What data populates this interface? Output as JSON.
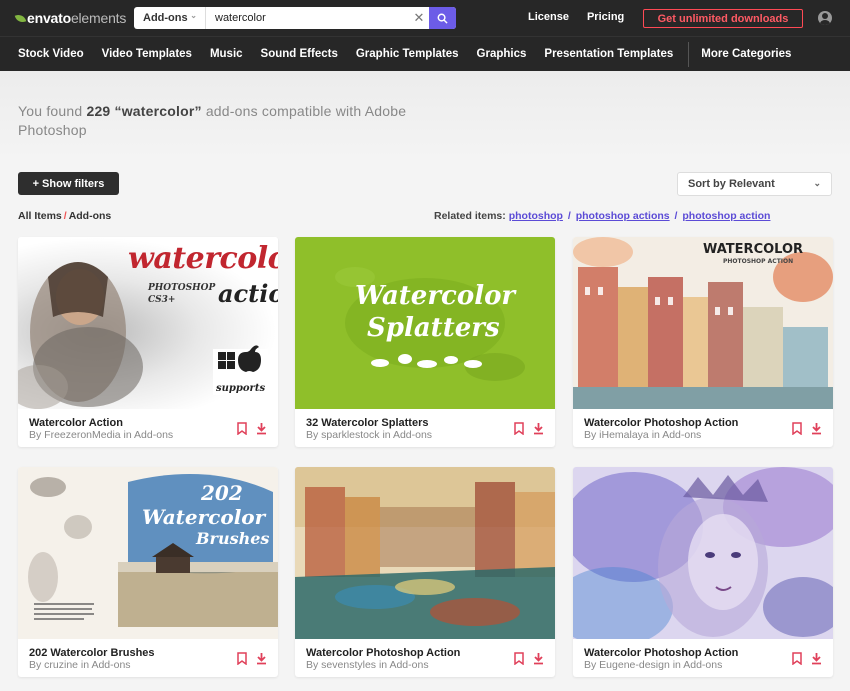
{
  "header": {
    "logo_main": "envato",
    "logo_sub": "elements",
    "search_category": "Add-ons",
    "search_value": "watercolor",
    "links": [
      "License",
      "Pricing"
    ],
    "cta": "Get unlimited downloads"
  },
  "nav": {
    "items": [
      "Stock Video",
      "Video Templates",
      "Music",
      "Sound Effects",
      "Graphic Templates",
      "Graphics",
      "Presentation Templates"
    ],
    "more": "More Categories"
  },
  "results": {
    "prefix": "You found",
    "count": "229",
    "query": "“watercolor”",
    "suffix": "add-ons compatible with Adobe Photoshop"
  },
  "filters": {
    "show_filters": "+ Show filters",
    "sort_label": "Sort by Relevant"
  },
  "breadcrumb": {
    "root": "All Items",
    "current": "Add-ons"
  },
  "related": {
    "label": "Related items:",
    "items": [
      "photoshop",
      "photoshop actions",
      "photoshop action"
    ]
  },
  "cards": [
    {
      "title": "Watercolor Action",
      "author": "By FreezeronMedia in Add-ons",
      "art": [
        "watercolor",
        "action",
        "PHOTOSHOP CS3+",
        "supports"
      ]
    },
    {
      "title": "32 Watercolor Splatters",
      "author": "By sparklestock in Add-ons",
      "art": [
        "Watercolor",
        "Splatters"
      ]
    },
    {
      "title": "Watercolor Photoshop Action",
      "author": "By iHemalaya in Add-ons",
      "art": [
        "WATERCOLOR",
        "PHOTOSHOP ACTION"
      ]
    },
    {
      "title": "202 Watercolor Brushes",
      "author": "By cruzine in Add-ons",
      "art": [
        "202",
        "Watercolor",
        "Brushes"
      ]
    },
    {
      "title": "Watercolor Photoshop Action",
      "author": "By sevenstyles in Add-ons",
      "art": []
    },
    {
      "title": "Watercolor Photoshop Action",
      "author": "By Eugene-design in Add-ons",
      "art": []
    }
  ],
  "colors": {
    "header_bg": "#272727",
    "accent_purple": "#6c5ce7",
    "cta_red": "#ff4a55",
    "bookmark_pink": "#e0405a",
    "splatter_green": "#8fbf2a"
  },
  "icons": [
    "search-icon",
    "clear-icon",
    "chevron-down-icon",
    "user-icon",
    "bookmark-icon",
    "download-icon"
  ]
}
